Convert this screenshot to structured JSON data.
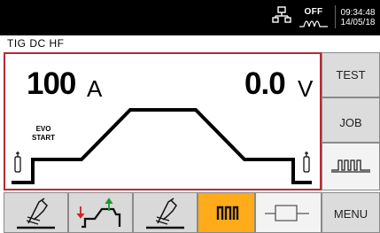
{
  "status": {
    "output_state": "OFF",
    "time": "09:34:48",
    "date": "14/05/18"
  },
  "mode": "TIG  DC  HF",
  "display": {
    "current_value": "100",
    "current_unit": "A",
    "voltage_value": "0.0",
    "voltage_unit": "V",
    "start_label_line1": "EVO",
    "start_label_line2": "START"
  },
  "side_buttons": {
    "test": "TEST",
    "job": "JOB",
    "menu": "MENU"
  },
  "colors": {
    "panel_border": "#b52a33",
    "active_tool": "#ffab1a",
    "status_bar": "#000000"
  },
  "icons": [
    "network-icon",
    "arc-off-icon",
    "gas-bottle-icon",
    "torch-icon",
    "process-sequence-icon",
    "pulse-icon",
    "square-wave-icon"
  ]
}
